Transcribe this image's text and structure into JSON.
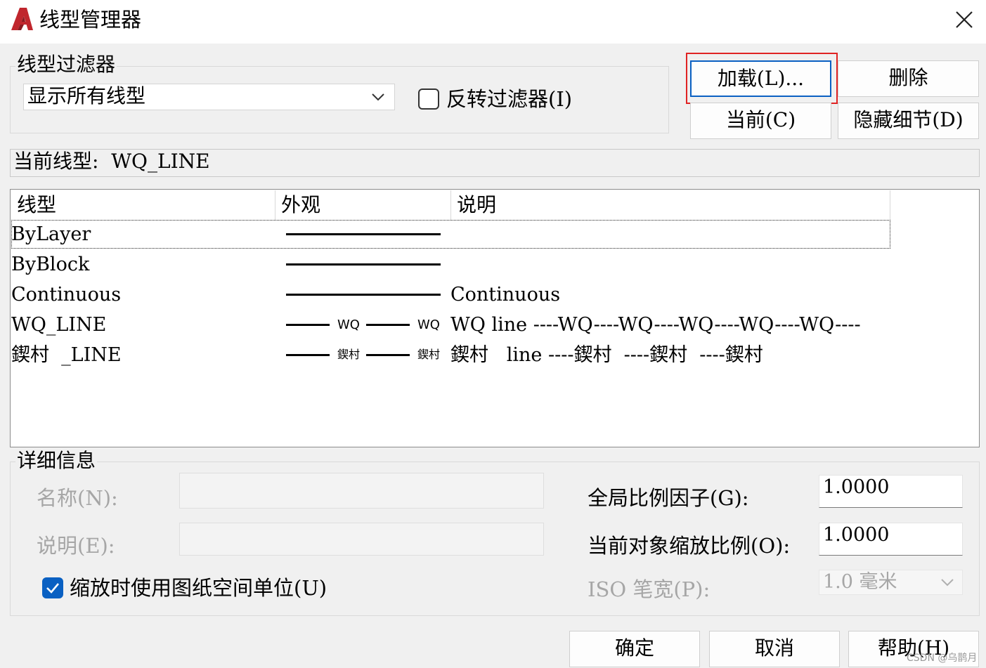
{
  "window": {
    "title": "线型管理器"
  },
  "filter": {
    "group_label": "线型过滤器",
    "selected": "显示所有线型",
    "invert_label": "反转过滤器(I)",
    "invert_checked": false
  },
  "buttons": {
    "load": "加载(L)...",
    "delete": "删除",
    "current": "当前(C)",
    "hide_details": "隐藏细节(D)",
    "ok": "确定",
    "cancel": "取消",
    "help": "帮助(H)"
  },
  "current_linetype": "当前线型:  WQ_LINE",
  "table": {
    "headers": [
      "线型",
      "外观",
      "说明"
    ],
    "rows": [
      {
        "name": "ByLayer",
        "appearance": "continuous",
        "description": ""
      },
      {
        "name": "ByBlock",
        "appearance": "continuous",
        "description": ""
      },
      {
        "name": "Continuous",
        "appearance": "continuous",
        "description": "Continuous"
      },
      {
        "name": "WQ_LINE",
        "appearance": "dash-text",
        "appearance_text": "WQ",
        "description": "WQ line ----WQ----WQ----WQ----WQ----WQ----"
      },
      {
        "name": "鍥村  _LINE",
        "appearance": "dash-text",
        "appearance_text": "鍥村",
        "description": "鍥村   line ----鍥村  ----鍥村  ----鍥村"
      }
    ]
  },
  "details": {
    "group_label": "详细信息",
    "name_label": "名称(N):",
    "name_value": "",
    "desc_label": "说明(E):",
    "desc_value": "",
    "paper_space_label": "缩放时使用图纸空间单位(U)",
    "paper_space_checked": true,
    "global_scale_label": "全局比例因子(G):",
    "global_scale_value": "1.0000",
    "object_scale_label": "当前对象缩放比例(O):",
    "object_scale_value": "1.0000",
    "iso_pen_label": "ISO 笔宽(P):",
    "iso_pen_value": "1.0 毫米"
  },
  "watermark": "CSDN @乌鹊月",
  "colors": {
    "accent": "#0a60c2",
    "highlight": "#e02323",
    "app_icon": "#c0262d"
  }
}
